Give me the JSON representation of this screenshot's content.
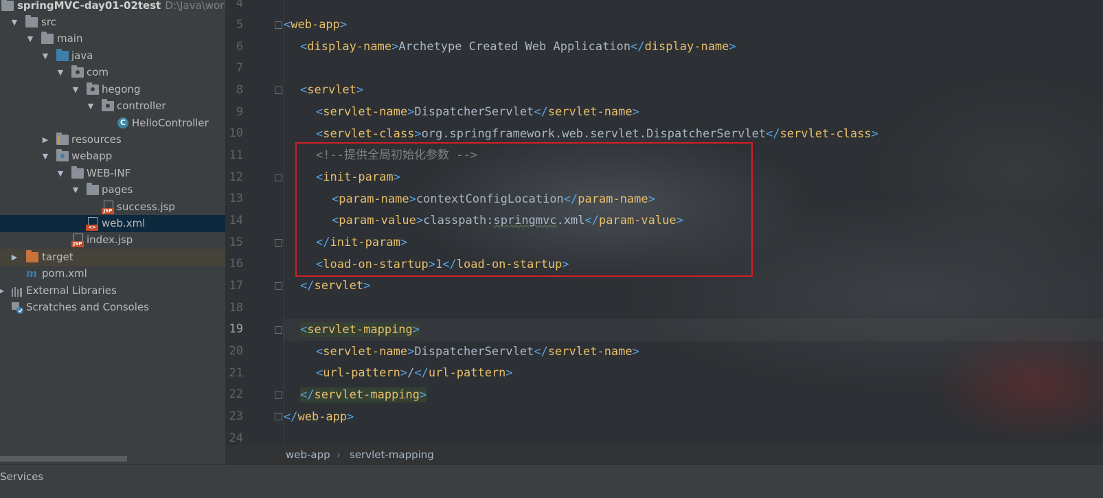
{
  "project_tree": {
    "root": {
      "name": "springMVC-day01-02test",
      "path": "D:\\Java\\work"
    },
    "items": [
      {
        "label": "src",
        "icon": "folder-icon"
      },
      {
        "label": "main",
        "icon": "folder-icon"
      },
      {
        "label": "java",
        "icon": "source-folder-icon"
      },
      {
        "label": "com",
        "icon": "package-icon"
      },
      {
        "label": "hegong",
        "icon": "package-icon"
      },
      {
        "label": "controller",
        "icon": "package-icon"
      },
      {
        "label": "HelloController",
        "icon": "class-icon",
        "glyph": "C"
      },
      {
        "label": "resources",
        "icon": "resources-folder-icon"
      },
      {
        "label": "webapp",
        "icon": "web-folder-icon"
      },
      {
        "label": "WEB-INF",
        "icon": "folder-icon"
      },
      {
        "label": "pages",
        "icon": "folder-icon"
      },
      {
        "label": "success.jsp",
        "icon": "jsp-file-icon",
        "tag": "JSP"
      },
      {
        "label": "web.xml",
        "icon": "xml-file-icon",
        "tag": "<>"
      },
      {
        "label": "index.jsp",
        "icon": "jsp-file-icon",
        "tag": "JSP"
      },
      {
        "label": "target",
        "icon": "excluded-folder-icon"
      },
      {
        "label": "pom.xml",
        "icon": "maven-icon",
        "glyph": "m"
      },
      {
        "label": "External Libraries",
        "icon": "libraries-icon"
      },
      {
        "label": "Scratches and Consoles",
        "icon": "scratches-icon"
      }
    ]
  },
  "editor": {
    "line_numbers": [
      "4",
      "5",
      "6",
      "7",
      "8",
      "9",
      "10",
      "11",
      "12",
      "13",
      "14",
      "15",
      "16",
      "17",
      "18",
      "19",
      "20",
      "21",
      "22",
      "23",
      "24"
    ],
    "current_line": "19",
    "lines": {
      "l5_open": "web-app",
      "l6_open": "display-name",
      "l6_text": "Archetype Created Web Application",
      "l6_close": "display-name",
      "l8_open": "servlet",
      "l9_open": "servlet-name",
      "l9_text": "DispatcherServlet",
      "l9_close": "servlet-name",
      "l10_open": "servlet-class",
      "l10_text": "org.springframework.web.servlet.DispatcherServlet",
      "l10_close": "servlet-class",
      "l11_comment": "<!--提供全局初始化参数 -->",
      "l12_open": "init-param",
      "l13_open": "param-name",
      "l13_text": "contextConfigLocation",
      "l13_close": "param-name",
      "l14_open": "param-value",
      "l14_text_a": "classpath:",
      "l14_text_b": "springmvc",
      "l14_text_c": ".xml",
      "l14_close": "param-value",
      "l15_close": "init-param",
      "l16_open": "load-on-startup",
      "l16_text": "1",
      "l16_close": "load-on-startup",
      "l17_close": "servlet",
      "l19_open": "servlet-mapping",
      "l20_open": "servlet-name",
      "l20_text": "DispatcherServlet",
      "l20_close": "servlet-name",
      "l21_open": "url-pattern",
      "l21_text": "/",
      "l21_close": "url-pattern",
      "l22_close": "servlet-mapping",
      "l23_close": "web-app"
    }
  },
  "breadcrumbs": {
    "items": [
      "web-app",
      "servlet-mapping"
    ],
    "separator": "›"
  },
  "bottom_bar": {
    "services_label": "Services"
  },
  "colors": {
    "tag": "#e8bf6a",
    "bracket": "#57a6e6",
    "text": "#a9b7c6",
    "comment": "#808080",
    "highlight_box": "#d21f26",
    "selection": "#0d293e"
  }
}
